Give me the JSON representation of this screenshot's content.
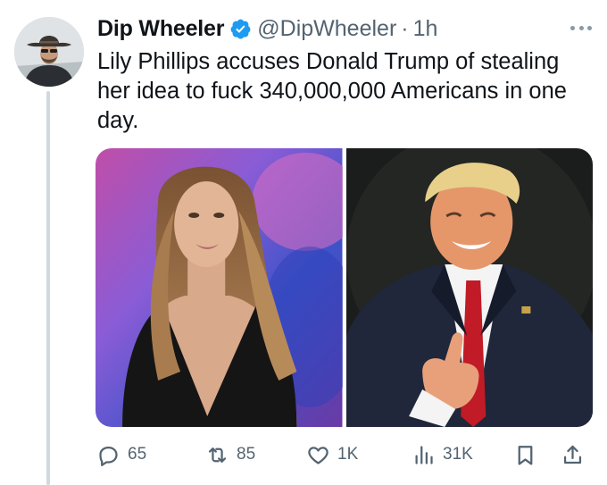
{
  "tweet": {
    "author_name": "Dip Wheeler",
    "handle": "@DipWheeler",
    "separator": "·",
    "time": "1h",
    "text": "Lily Phillips accuses Donald Trump of stealing her idea to fuck 340,000,000 Americans in one day."
  },
  "actions": {
    "replies": "65",
    "reposts": "85",
    "likes": "1K",
    "views": "31K"
  },
  "colors": {
    "text_primary": "#0f1419",
    "text_secondary": "#536471",
    "verified_blue": "#1d9bf0",
    "thread_line": "#cfd9de"
  },
  "icons": [
    "verified-badge-icon",
    "more-options-icon",
    "reply-icon",
    "repost-icon",
    "like-icon",
    "views-icon",
    "bookmark-icon",
    "share-icon"
  ]
}
